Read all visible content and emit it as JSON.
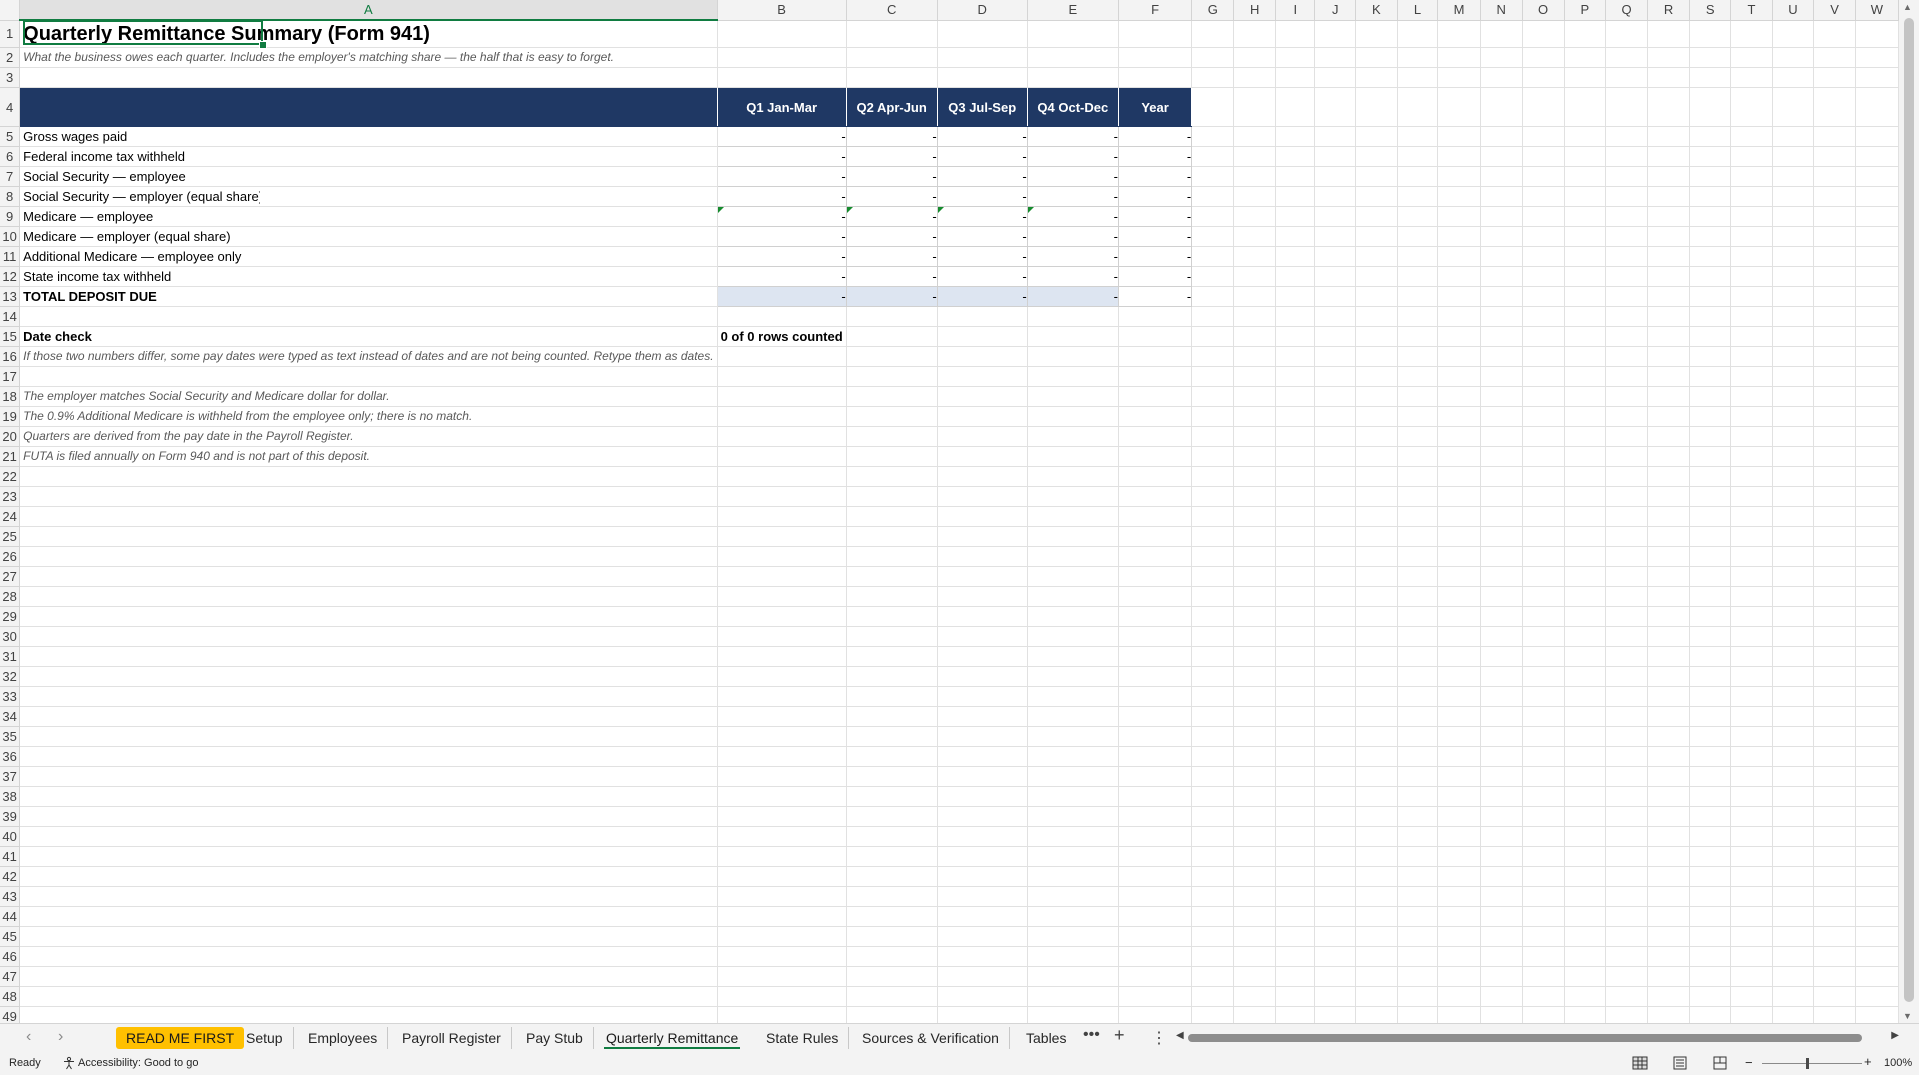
{
  "columns": [
    "A",
    "B",
    "C",
    "D",
    "E",
    "F",
    "G",
    "H",
    "I",
    "J",
    "K",
    "L",
    "M",
    "N",
    "O",
    "P",
    "Q",
    "R",
    "S",
    "T",
    "U",
    "V",
    "W"
  ],
  "row_numbers": [
    "1",
    "2",
    "3",
    "4",
    "5",
    "6",
    "7",
    "8",
    "9",
    "10",
    "11",
    "12",
    "13",
    "14",
    "15",
    "16",
    "17",
    "18",
    "19",
    "20",
    "21",
    "22",
    "23",
    "24",
    "25",
    "26",
    "27",
    "28",
    "29",
    "30",
    "31",
    "32",
    "33",
    "34",
    "35",
    "36",
    "37",
    "38",
    "39",
    "40",
    "41",
    "42",
    "43",
    "44",
    "45",
    "46",
    "47",
    "48",
    "49"
  ],
  "sheet": {
    "title": "Quarterly Remittance Summary (Form 941)",
    "subtitle": "What the business owes each quarter. Includes the employer's matching share — the half that is easy to forget.",
    "header": [
      "Q1  Jan-Mar",
      "Q2  Apr-Jun",
      "Q3  Jul-Sep",
      "Q4  Oct-Dec",
      "Year"
    ],
    "rows": [
      {
        "label": "Gross wages paid",
        "values": [
          "-",
          "-",
          "-",
          "-",
          "-"
        ]
      },
      {
        "label": "Federal income tax withheld",
        "values": [
          "-",
          "-",
          "-",
          "-",
          "-"
        ]
      },
      {
        "label": "Social Security — employee",
        "values": [
          "-",
          "-",
          "-",
          "-",
          "-"
        ]
      },
      {
        "label": "Social Security — employer (equal share)",
        "values": [
          "-",
          "-",
          "-",
          "-",
          "-"
        ]
      },
      {
        "label": "Medicare — employee",
        "values": [
          "-",
          "-",
          "-",
          "-",
          "-"
        ]
      },
      {
        "label": "Medicare — employer (equal share)",
        "values": [
          "-",
          "-",
          "-",
          "-",
          "-"
        ]
      },
      {
        "label": "Additional Medicare — employee only",
        "values": [
          "-",
          "-",
          "-",
          "-",
          "-"
        ]
      },
      {
        "label": "State income tax withheld",
        "values": [
          "-",
          "-",
          "-",
          "-",
          "-"
        ]
      }
    ],
    "total": {
      "label": "TOTAL DEPOSIT DUE",
      "values": [
        "-",
        "-",
        "-",
        "-",
        "-"
      ]
    },
    "date_check_label": "Date check",
    "date_check_value": "0 of 0 rows counted",
    "date_check_note": "If those two numbers differ, some pay dates were typed as text instead of dates and are not being counted. Retype them as dates.",
    "notes": [
      "The employer matches Social Security and Medicare dollar for dollar.",
      "The 0.9% Additional Medicare is withheld from the employee only; there is no match.",
      "Quarters are derived from the pay date in the Payroll Register.",
      "FUTA is filed annually on Form 940 and is not part of this deposit."
    ]
  },
  "tabs": [
    "READ ME FIRST",
    "Setup",
    "Employees",
    "Payroll Register",
    "Pay Stub",
    "Quarterly Remittance",
    "State Rules",
    "Sources & Verification",
    "Tables"
  ],
  "active_tab": "Quarterly Remittance",
  "status": {
    "ready": "Ready",
    "accessibility": "Accessibility: Good to go",
    "zoom": "100%"
  },
  "colors": {
    "header_fill": "#1f3864",
    "total_fill": "#dde5f1",
    "accent": "#107c41",
    "readme_tab": "#ffc000"
  }
}
